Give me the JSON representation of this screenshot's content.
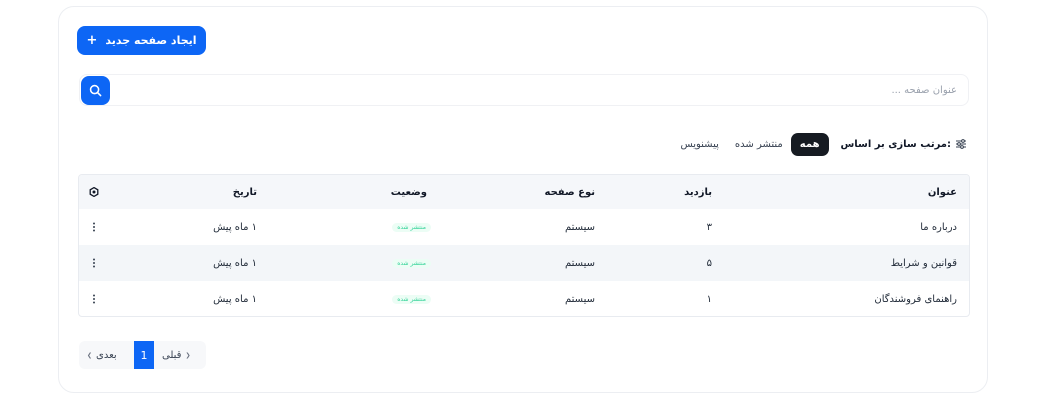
{
  "header": {
    "create_button_label": "ایجاد صفحه جدید",
    "create_button_icon": "+"
  },
  "search": {
    "placeholder": "عنوان صفحه ...",
    "value": ""
  },
  "filters": {
    "sort_label": "مرتب سازی بر اساس:",
    "tabs": [
      {
        "label": "همه",
        "active": true
      },
      {
        "label": "منتشر شده",
        "active": false
      },
      {
        "label": "پیشنویس",
        "active": false
      }
    ]
  },
  "table": {
    "columns": [
      "عنوان",
      "بازدید",
      "نوع صفحه",
      "وضعیت",
      "تاریخ"
    ],
    "rows": [
      {
        "title": "درباره ما",
        "visits": "۳",
        "type": "سیستم",
        "status": "منتشر شده",
        "date": "۱ ماه پیش"
      },
      {
        "title": "قوانین و شرایط",
        "visits": "۵",
        "type": "سیستم",
        "status": "منتشر شده",
        "date": "۱ ماه پیش"
      },
      {
        "title": "راهنمای فروشندگان",
        "visits": "۱",
        "type": "سیستم",
        "status": "منتشر شده",
        "date": "۱ ماه پیش"
      }
    ]
  },
  "pagination": {
    "prev_label": "قبلی",
    "current_page": "1",
    "next_label": "بعدی"
  },
  "colors": {
    "accent": "#0d66f5",
    "active_tab": "#161b22",
    "status_published": "#34d399"
  }
}
